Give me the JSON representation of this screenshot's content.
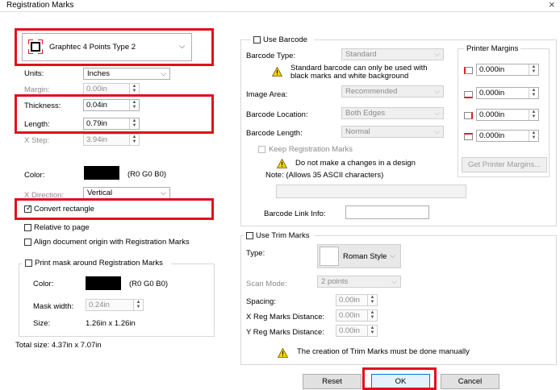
{
  "window": {
    "title": "Registration Marks",
    "close_glyph": "×"
  },
  "marks_type": {
    "value": "Graphtec 4 Points Type 2"
  },
  "units": {
    "label": "Units:",
    "value": "Inches"
  },
  "margin": {
    "label": "Margin:",
    "value": "0.00in"
  },
  "thickness": {
    "label": "Thickness:",
    "value": "0.04in"
  },
  "length": {
    "label": "Length:",
    "value": "0.79in"
  },
  "xstep": {
    "label": "X Step:",
    "value": "3.94in"
  },
  "color": {
    "label": "Color:",
    "rgb": "(R0 G0 B0)",
    "swatch": "#000000"
  },
  "xdirection": {
    "label": "X Direction:",
    "value": "Vertical"
  },
  "convert_rectangle": {
    "label": "Convert rectangle",
    "checked": true
  },
  "relative_to_page": {
    "label": "Relative to page"
  },
  "align_origin": {
    "label": "Align document origin with Registration Marks"
  },
  "print_mask": {
    "label": "Print mask around Registration Marks",
    "color_label": "Color:",
    "color_rgb": "(R0 G0 B0)",
    "mask_width_label": "Mask width:",
    "mask_width_value": "0.24in",
    "size_label": "Size:",
    "size_value": "1.26in x 1.26in"
  },
  "total_size": "Total size:  4.37in x 7.07in",
  "barcode": {
    "use_label": "Use Barcode",
    "type_label": "Barcode Type:",
    "type_value": "Standard",
    "warning": "Standard barcode can only be used with black marks and white background",
    "image_area_label": "Image Area:",
    "image_area_value": "Recommended",
    "location_label": "Barcode Location:",
    "location_value": "Both Edges",
    "length_label": "Barcode Length:",
    "length_value": "Normal",
    "keep_label": "Keep Registration Marks",
    "do_not_make": "Do not make a changes in a design",
    "note": "Note: (Allows 35 ASCII characters)",
    "link_label": "Barcode Link Info:"
  },
  "printer_margins": {
    "title": "Printer Margins",
    "values": [
      "0.000in",
      "0.000in",
      "0.000in",
      "0.000in"
    ],
    "get_button": "Get Printer Margins..."
  },
  "trim": {
    "use_label": "Use Trim Marks",
    "type_label": "Type:",
    "type_value": "Roman Style",
    "scan_label": "Scan Mode:",
    "scan_value": "2 points",
    "spacing_label": "Spacing:",
    "spacing_value": "0.00in",
    "xreg_label": "X Reg Marks Distance:",
    "xreg_value": "0.00in",
    "yreg_label": "Y Reg Marks Distance:",
    "yreg_value": "0.00in",
    "warning": "The creation of Trim Marks must be done manually"
  },
  "buttons": {
    "reset": "Reset",
    "ok": "OK",
    "cancel": "Cancel"
  }
}
